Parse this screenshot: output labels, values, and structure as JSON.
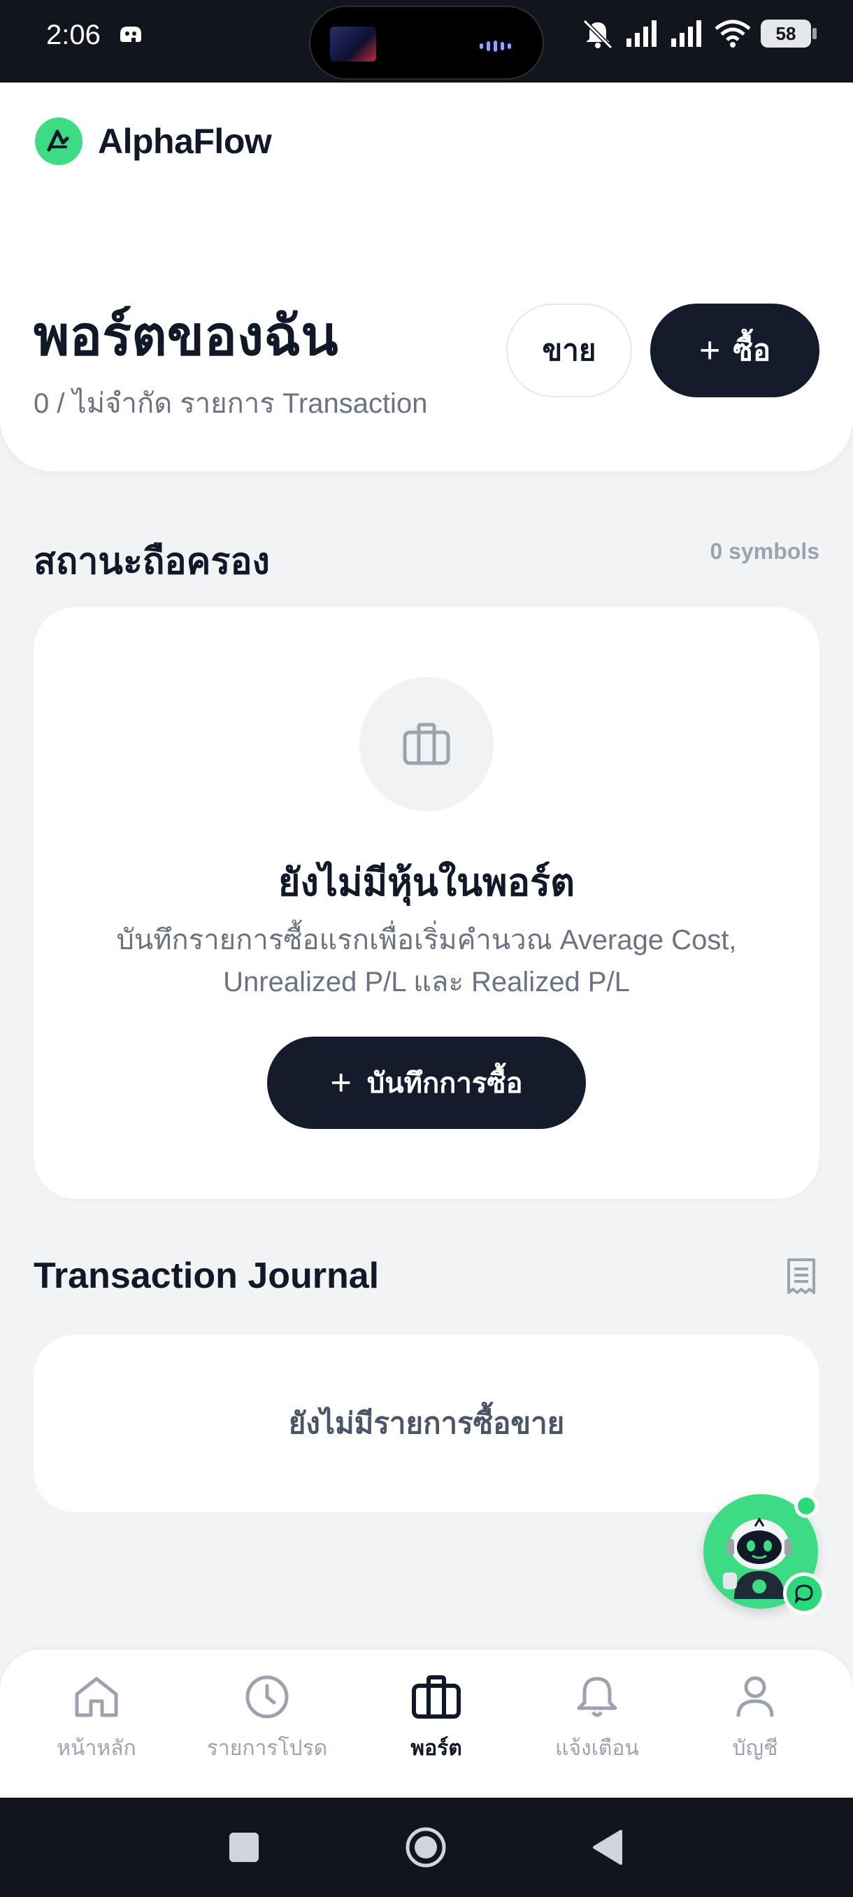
{
  "status_bar": {
    "time": "2:06",
    "battery": "58"
  },
  "brand": {
    "name": "AlphaFlow"
  },
  "header": {
    "title": "พอร์ตของฉัน",
    "subtitle": "0 / ไม่จำกัด รายการ Transaction",
    "sell_label": "ขาย",
    "buy_label": "ซื้อ"
  },
  "holdings": {
    "title": "สถานะถือครอง",
    "count": "0 symbols",
    "empty_title": "ยังไม่มีหุ้นในพอร์ต",
    "empty_desc_line1": "บันทึกรายการซื้อแรกเพื่อเริ่มคำนวณ Average Cost,",
    "empty_desc_line2": "Unrealized P/L และ Realized P/L",
    "record_label": "บันทึกการซื้อ"
  },
  "journal": {
    "title": "Transaction Journal",
    "empty": "ยังไม่มีรายการซื้อขาย"
  },
  "bottom_nav": {
    "items": [
      {
        "label": "หน้าหลัก",
        "icon": "home-icon"
      },
      {
        "label": "รายการโปรด",
        "icon": "clock-icon"
      },
      {
        "label": "พอร์ต",
        "icon": "briefcase-icon",
        "active": true
      },
      {
        "label": "แจ้งเตือน",
        "icon": "bell-icon"
      },
      {
        "label": "บัญชี",
        "icon": "user-icon"
      }
    ]
  },
  "colors": {
    "accent": "#3ddc84",
    "primary_dark": "#141b2b",
    "muted": "#9ca3af"
  }
}
